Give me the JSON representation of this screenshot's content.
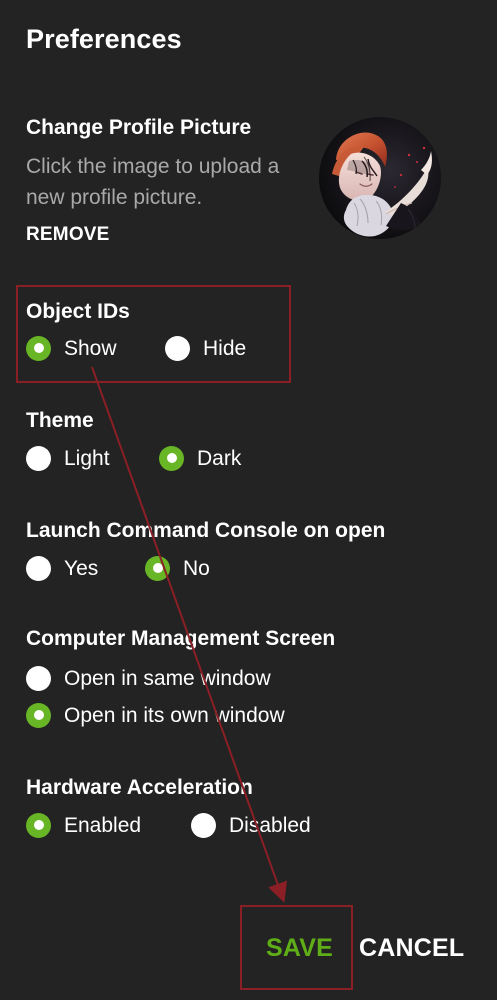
{
  "preferences": {
    "title": "Preferences"
  },
  "profile": {
    "title": "Change Profile Picture",
    "hint": "Click the image to upload a new profile picture.",
    "remove_label": "REMOVE"
  },
  "object_ids": {
    "title": "Object IDs",
    "options": [
      {
        "label": "Show",
        "selected": true
      },
      {
        "label": "Hide",
        "selected": false
      }
    ]
  },
  "theme": {
    "title": "Theme",
    "options": [
      {
        "label": "Light",
        "selected": false
      },
      {
        "label": "Dark",
        "selected": true
      }
    ]
  },
  "launch_console": {
    "title": "Launch Command Console on open",
    "options": [
      {
        "label": "Yes",
        "selected": false
      },
      {
        "label": "No",
        "selected": true
      }
    ]
  },
  "computer_management": {
    "title": "Computer Management Screen",
    "options": [
      {
        "label": "Open in same window",
        "selected": false
      },
      {
        "label": "Open in its own window",
        "selected": true
      }
    ]
  },
  "hardware_acceleration": {
    "title": "Hardware Acceleration",
    "options": [
      {
        "label": "Enabled",
        "selected": true
      },
      {
        "label": "Disabled",
        "selected": false
      }
    ]
  },
  "actions": {
    "save_label": "SAVE",
    "cancel_label": "CANCEL"
  },
  "colors": {
    "background": "#232323",
    "accent": "#68b526",
    "hint": "#a9a9a9",
    "annotation": "#8b1f26"
  },
  "icons": {
    "radio_selected": "radio-selected-icon",
    "radio_unselected": "radio-unselected-icon",
    "avatar": "profile-avatar"
  }
}
